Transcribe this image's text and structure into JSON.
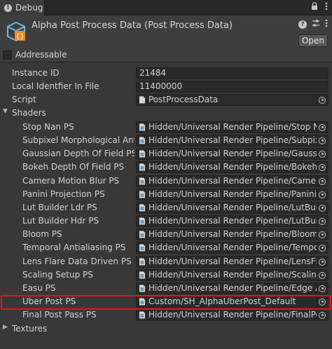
{
  "tab": {
    "label": "Debug",
    "lock_icon": "lock-icon",
    "menu_icon": "kebab-menu-icon"
  },
  "header": {
    "title": "Alpha Post Process Data (Post Process Data)",
    "open_label": "Open",
    "help_icon": "?",
    "settings_icon": "sliders-icon",
    "menu_icon": "kebab-menu-icon"
  },
  "addressable": {
    "label": "Addressable",
    "checked": false
  },
  "properties": {
    "instance_id": {
      "label": "Instance ID",
      "value": "21484"
    },
    "local_identifier": {
      "label": "Local Identfier In File",
      "value": "11400000"
    },
    "script": {
      "label": "Script",
      "value": "PostProcessData"
    }
  },
  "shaders": {
    "label": "Shaders",
    "items": [
      {
        "label": "Stop Nan PS",
        "value": "Hidden/Universal Render Pipeline/Stop NaN"
      },
      {
        "label": "Subpixel Morphological Antial",
        "value": "Hidden/Universal Render Pipeline/SubpixelMorphologicalAntialiasing"
      },
      {
        "label": "Gaussian Depth Of Field PS",
        "value": "Hidden/Universal Render Pipeline/GaussianDepthOfField"
      },
      {
        "label": "Bokeh Depth Of Field PS",
        "value": "Hidden/Universal Render Pipeline/BokehDepthOfField"
      },
      {
        "label": "Camera Motion Blur PS",
        "value": "Hidden/Universal Render Pipeline/CameraMotionBlur"
      },
      {
        "label": "Panini Projection PS",
        "value": "Hidden/Universal Render Pipeline/PaniniProjection"
      },
      {
        "label": "Lut Builder Ldr PS",
        "value": "Hidden/Universal Render Pipeline/LutBuilderLdr"
      },
      {
        "label": "Lut Builder Hdr PS",
        "value": "Hidden/Universal Render Pipeline/LutBuilderHdr"
      },
      {
        "label": "Bloom PS",
        "value": "Hidden/Universal Render Pipeline/Bloom"
      },
      {
        "label": "Temporal Antialiasing PS",
        "value": "Hidden/Universal Render Pipeline/TemporalAA"
      },
      {
        "label": "Lens Flare Data Driven PS",
        "value": "Hidden/Universal Render Pipeline/LensFlareDataDriven"
      },
      {
        "label": "Scaling Setup PS",
        "value": "Hidden/Universal Render Pipeline/Scaling Setup"
      },
      {
        "label": "Easu PS",
        "value": "Hidden/Universal Render Pipeline/Edge Adaptive Spatial Upsampling"
      },
      {
        "label": "Uber Post PS",
        "value": "Custom/SH_AlphaUberPost_Default"
      },
      {
        "label": "Final Post Pass PS",
        "value": "Hidden/Universal Render Pipeline/FinalPost"
      }
    ]
  },
  "textures": {
    "label": "Textures"
  },
  "highlight_color": "#e8101a"
}
